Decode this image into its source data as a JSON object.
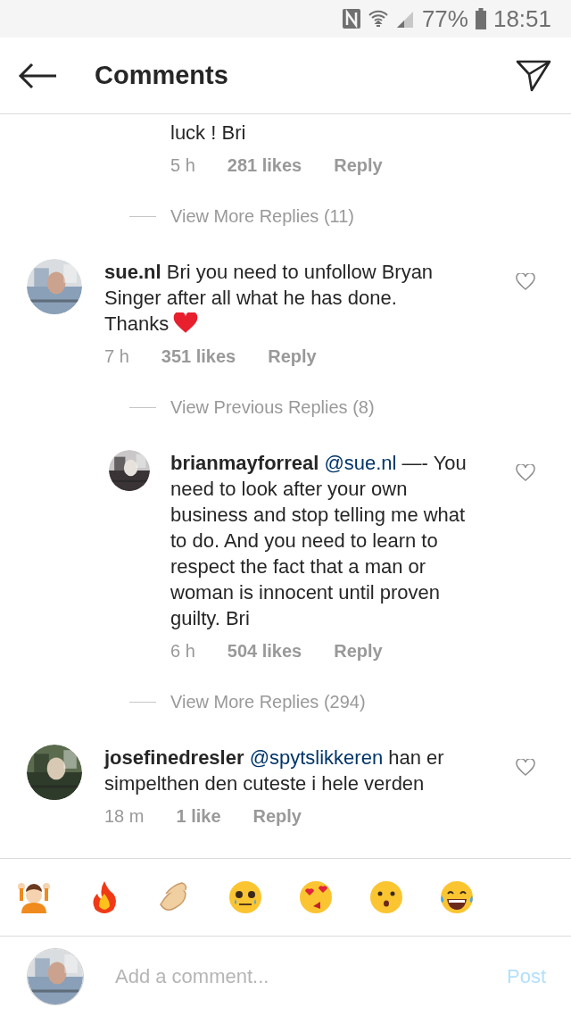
{
  "status_bar": {
    "battery": "77%",
    "time": "18:51"
  },
  "header": {
    "title": "Comments"
  },
  "comments": [
    {
      "kind": "reply-tail",
      "text": "luck ! Bri",
      "time": "5 h",
      "likes": "281 likes",
      "reply": "Reply"
    },
    {
      "kind": "more",
      "label": "View More Replies (11)"
    },
    {
      "kind": "comment",
      "user": "sue.nl",
      "text": "Bri you need to unfollow Bryan Singer after all what he has done. Thanks",
      "heart_emoji": true,
      "time": "7 h",
      "likes": "351 likes",
      "reply": "Reply"
    },
    {
      "kind": "more",
      "label": "View Previous Replies (8)"
    },
    {
      "kind": "reply",
      "user": "brianmayforreal",
      "mention": "@sue.nl",
      "text": "—- You need to look after your own business and stop telling me what to do. And you need to learn to respect the fact that a man or woman is innocent until proven guilty. Bri",
      "time": "6 h",
      "likes": "504 likes",
      "reply": "Reply"
    },
    {
      "kind": "more",
      "label": "View More Replies (294)"
    },
    {
      "kind": "comment",
      "user": "josefinedresler",
      "mention": "@spytslikkeren",
      "text": "han er simpelthen den cuteste i hele verden",
      "time": "18 m",
      "likes": "1 like",
      "reply": "Reply"
    }
  ],
  "emojis": [
    {
      "kind": "hands-up"
    },
    {
      "kind": "fire"
    },
    {
      "kind": "clap"
    },
    {
      "kind": "crying"
    },
    {
      "kind": "heart-eyes"
    },
    {
      "kind": "surprised"
    },
    {
      "kind": "tears-of-joy"
    }
  ],
  "composer": {
    "placeholder": "Add a comment...",
    "post": "Post"
  }
}
